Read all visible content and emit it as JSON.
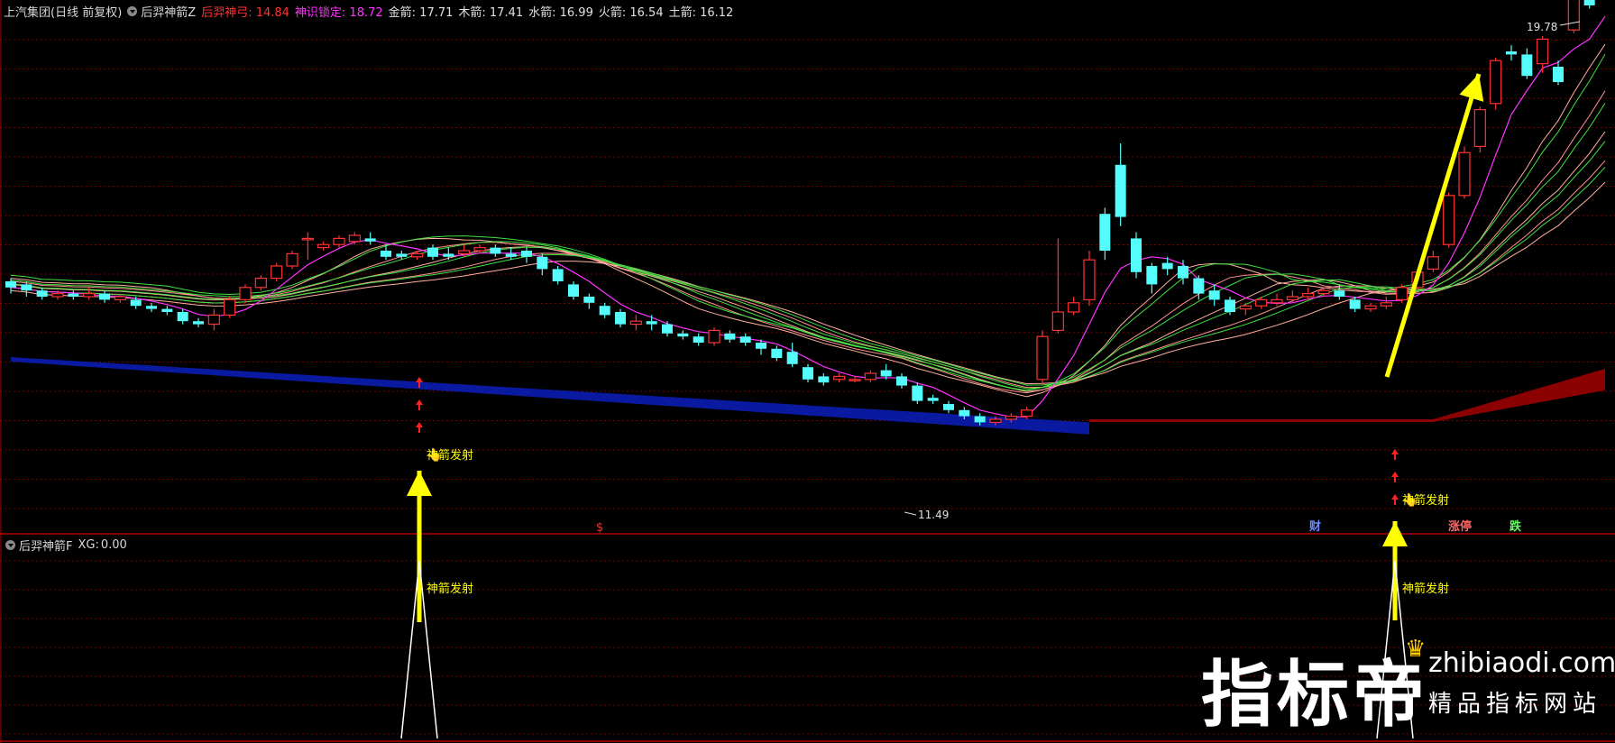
{
  "main_panel": {
    "stock_title": "上汽集团(日线 前复权)",
    "indicator_name": "后羿神箭Z",
    "values": [
      {
        "label": "后羿神弓:",
        "value": "14.84",
        "color": "#ff3333"
      },
      {
        "label": "神识锁定:",
        "value": "18.72",
        "color": "#ff33ff"
      },
      {
        "label": "金箭:",
        "value": "17.71",
        "color": "#e0e0e0"
      },
      {
        "label": "木箭:",
        "value": "17.41",
        "color": "#e0e0e0"
      },
      {
        "label": "水箭:",
        "value": "16.99",
        "color": "#e0e0e0"
      },
      {
        "label": "火箭:",
        "value": "16.54",
        "color": "#e0e0e0"
      },
      {
        "label": "土箭:",
        "value": "16.12",
        "color": "#e0e0e0"
      }
    ],
    "high_label": "19.78",
    "low_label": "11.49",
    "signal_text": "神箭发射",
    "marker_dollar": "$",
    "markers": [
      {
        "text": "财",
        "color": "#6a8cff"
      },
      {
        "text": "涨停",
        "color": "#ff6666"
      },
      {
        "text": "跌",
        "color": "#66ff66"
      }
    ]
  },
  "sub_panel": {
    "indicator_name": "后羿神箭F",
    "xg_label": "XG:",
    "xg_value": "0.00",
    "signal_text": "神箭发射"
  },
  "watermark": {
    "brand": "指标帝",
    "url": "zhibiaodi.com",
    "tagline": "精品指标网站"
  },
  "colors": {
    "up": "#ff3232",
    "down": "#54fcfc",
    "blue_band": "#0a1aa0",
    "red_band": "#8b0000",
    "grid": "#7a0000",
    "arrow": "#ffff00"
  }
}
